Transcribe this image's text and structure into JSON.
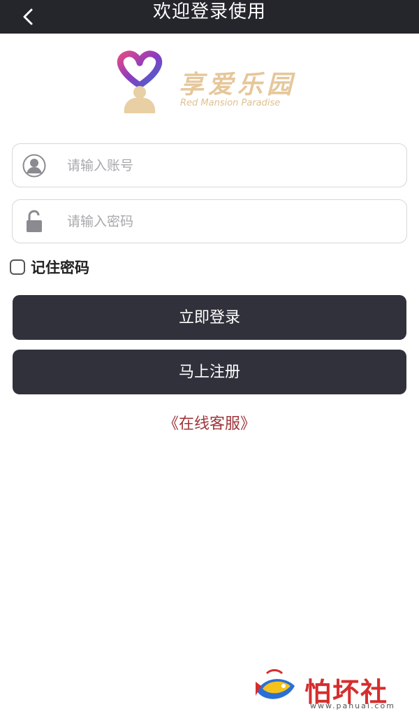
{
  "header": {
    "title": "欢迎登录使用",
    "back_icon": "chevron-left-icon"
  },
  "logo": {
    "name": "享爱乐园",
    "subtitle": "Red Mansion Paradise",
    "colors": [
      "#e6c79a",
      "#c63a8c",
      "#6a3fb0"
    ]
  },
  "form": {
    "account_placeholder": "请输入账号",
    "account_icon": "user-icon",
    "password_placeholder": "请输入密码",
    "password_icon": "lock-icon",
    "remember_label": "记住密码",
    "remember_checked": false
  },
  "actions": {
    "login_label": "立即登录",
    "register_label": "马上注册",
    "service_label": "《在线客服》"
  },
  "watermark": {
    "text": "怕坏社区",
    "url": "www.pahuai.com"
  },
  "colors": {
    "topbar": "#25252c",
    "button": "#31313c",
    "link": "#a0353a",
    "watermark": "#d62d2d"
  }
}
